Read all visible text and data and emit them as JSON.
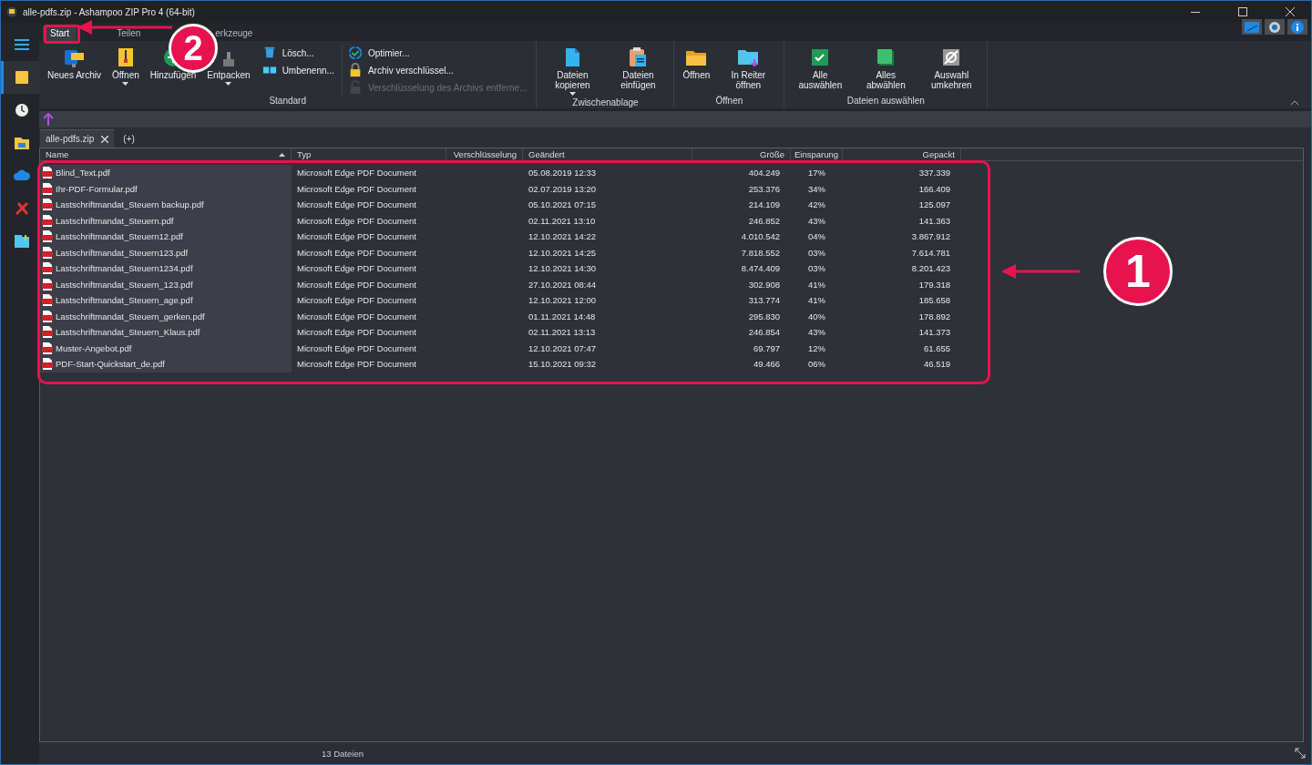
{
  "window": {
    "title": "alle-pdfs.zip - Ashampoo ZIP Pro 4 (64-bit)"
  },
  "sidebar": {
    "items": [
      {
        "selected": false
      },
      {
        "selected": true
      },
      {
        "selected": false
      },
      {
        "selected": false
      },
      {
        "selected": false
      },
      {
        "selected": false
      },
      {
        "selected": false
      }
    ]
  },
  "ribbon_tabs": [
    {
      "label": "Start",
      "selected": true
    },
    {
      "label": "Teilen",
      "selected": false
    },
    {
      "label": "erkzeuge",
      "selected": false
    }
  ],
  "ribbon_groups": [
    {
      "label": "Standard",
      "buttons": [
        {
          "kind": "large",
          "label": "Neues Archiv",
          "dropdown": false
        },
        {
          "kind": "large",
          "label": "Öffnen",
          "dropdown": true
        },
        {
          "kind": "large",
          "label": "Hinzufügen",
          "dropdown": false
        },
        {
          "kind": "large",
          "label": "Entpacken",
          "dropdown": true
        },
        {
          "kind": "stack",
          "items": [
            {
              "label": "Lösch...",
              "disabled": false
            },
            {
              "label": "Umbenenn...",
              "disabled": false
            }
          ]
        },
        {
          "kind": "stack",
          "items": [
            {
              "label": "Optimier...",
              "disabled": false
            },
            {
              "label": "Archiv verschlüssel...",
              "disabled": false
            },
            {
              "label": "Verschlüsselung des Archivs entferne...",
              "disabled": true
            }
          ]
        }
      ]
    },
    {
      "label": "Zwischenablage",
      "buttons": [
        {
          "kind": "large",
          "label": "Dateien kopieren",
          "dropdown": true
        },
        {
          "kind": "large",
          "label": "Dateien einfügen",
          "dropdown": false
        }
      ]
    },
    {
      "label": "Öffnen",
      "buttons": [
        {
          "kind": "large",
          "label": "Öffnen",
          "dropdown": false
        },
        {
          "kind": "large",
          "label": "In Reiter öffnen",
          "dropdown": false
        }
      ]
    },
    {
      "label": "Dateien auswählen",
      "buttons": [
        {
          "kind": "large",
          "label": "Alle auswählen",
          "dropdown": false
        },
        {
          "kind": "large",
          "label": "Alles abwählen",
          "dropdown": false
        },
        {
          "kind": "large",
          "label": "Auswahl umkehren",
          "dropdown": false
        }
      ]
    }
  ],
  "archive_tabs": [
    {
      "label": "alle-pdfs.zip",
      "selected": true,
      "closable": true
    },
    {
      "label": "(+)",
      "selected": false,
      "closable": false
    }
  ],
  "table": {
    "columns": [
      {
        "label": "Name",
        "sorted": true
      },
      {
        "label": "Typ",
        "sorted": false
      },
      {
        "label": "Verschlüsselung",
        "sorted": false
      },
      {
        "label": "Geändert",
        "sorted": false
      },
      {
        "label": "Größe",
        "sorted": false
      },
      {
        "label": "Einsparung",
        "sorted": false
      },
      {
        "label": "Gepackt",
        "sorted": false
      }
    ],
    "rows": [
      {
        "name": "Blind_Text.pdf",
        "type": "Microsoft Edge PDF Document",
        "modified": "05.08.2019 12:33",
        "size": "404.249",
        "saving": "17%",
        "packed": "337.339"
      },
      {
        "name": "Ihr-PDF-Formular.pdf",
        "type": "Microsoft Edge PDF Document",
        "modified": "02.07.2019 13:20",
        "size": "253.376",
        "saving": "34%",
        "packed": "166.409"
      },
      {
        "name": "Lastschriftmandat_Steuern backup.pdf",
        "type": "Microsoft Edge PDF Document",
        "modified": "05.10.2021 07:15",
        "size": "214.109",
        "saving": "42%",
        "packed": "125.097"
      },
      {
        "name": "Lastschriftmandat_Steuern.pdf",
        "type": "Microsoft Edge PDF Document",
        "modified": "02.11.2021 13:10",
        "size": "246.852",
        "saving": "43%",
        "packed": "141.363"
      },
      {
        "name": "Lastschriftmandat_Steuern12.pdf",
        "type": "Microsoft Edge PDF Document",
        "modified": "12.10.2021 14:22",
        "size": "4.010.542",
        "saving": "04%",
        "packed": "3.867.912"
      },
      {
        "name": "Lastschriftmandat_Steuern123.pdf",
        "type": "Microsoft Edge PDF Document",
        "modified": "12.10.2021 14:25",
        "size": "7.818.552",
        "saving": "03%",
        "packed": "7.614.781"
      },
      {
        "name": "Lastschriftmandat_Steuern1234.pdf",
        "type": "Microsoft Edge PDF Document",
        "modified": "12.10.2021 14:30",
        "size": "8.474.409",
        "saving": "03%",
        "packed": "8.201.423"
      },
      {
        "name": "Lastschriftmandat_Steuern_123.pdf",
        "type": "Microsoft Edge PDF Document",
        "modified": "27.10.2021 08:44",
        "size": "302.908",
        "saving": "41%",
        "packed": "179.318"
      },
      {
        "name": "Lastschriftmandat_Steuern_age.pdf",
        "type": "Microsoft Edge PDF Document",
        "modified": "12.10.2021 12:00",
        "size": "313.774",
        "saving": "41%",
        "packed": "185.658"
      },
      {
        "name": "Lastschriftmandat_Steuern_gerken.pdf",
        "type": "Microsoft Edge PDF Document",
        "modified": "01.11.2021 14:48",
        "size": "295.830",
        "saving": "40%",
        "packed": "178.892"
      },
      {
        "name": "Lastschriftmandat_Steuern_Klaus.pdf",
        "type": "Microsoft Edge PDF Document",
        "modified": "02.11.2021 13:13",
        "size": "246.854",
        "saving": "43%",
        "packed": "141.373"
      },
      {
        "name": "Muster-Angebot.pdf",
        "type": "Microsoft Edge PDF Document",
        "modified": "12.10.2021 07:47",
        "size": "69.797",
        "saving": "12%",
        "packed": "61.655"
      },
      {
        "name": "PDF-Start-Quickstart_de.pdf",
        "type": "Microsoft Edge PDF Document",
        "modified": "15.10.2021 09:32",
        "size": "49.466",
        "saving": "06%",
        "packed": "46.519"
      }
    ]
  },
  "status_bar": {
    "text": "13 Dateien"
  },
  "annotations": [
    {
      "kind": "callout",
      "label": "1"
    },
    {
      "kind": "callout",
      "label": "2"
    }
  ]
}
